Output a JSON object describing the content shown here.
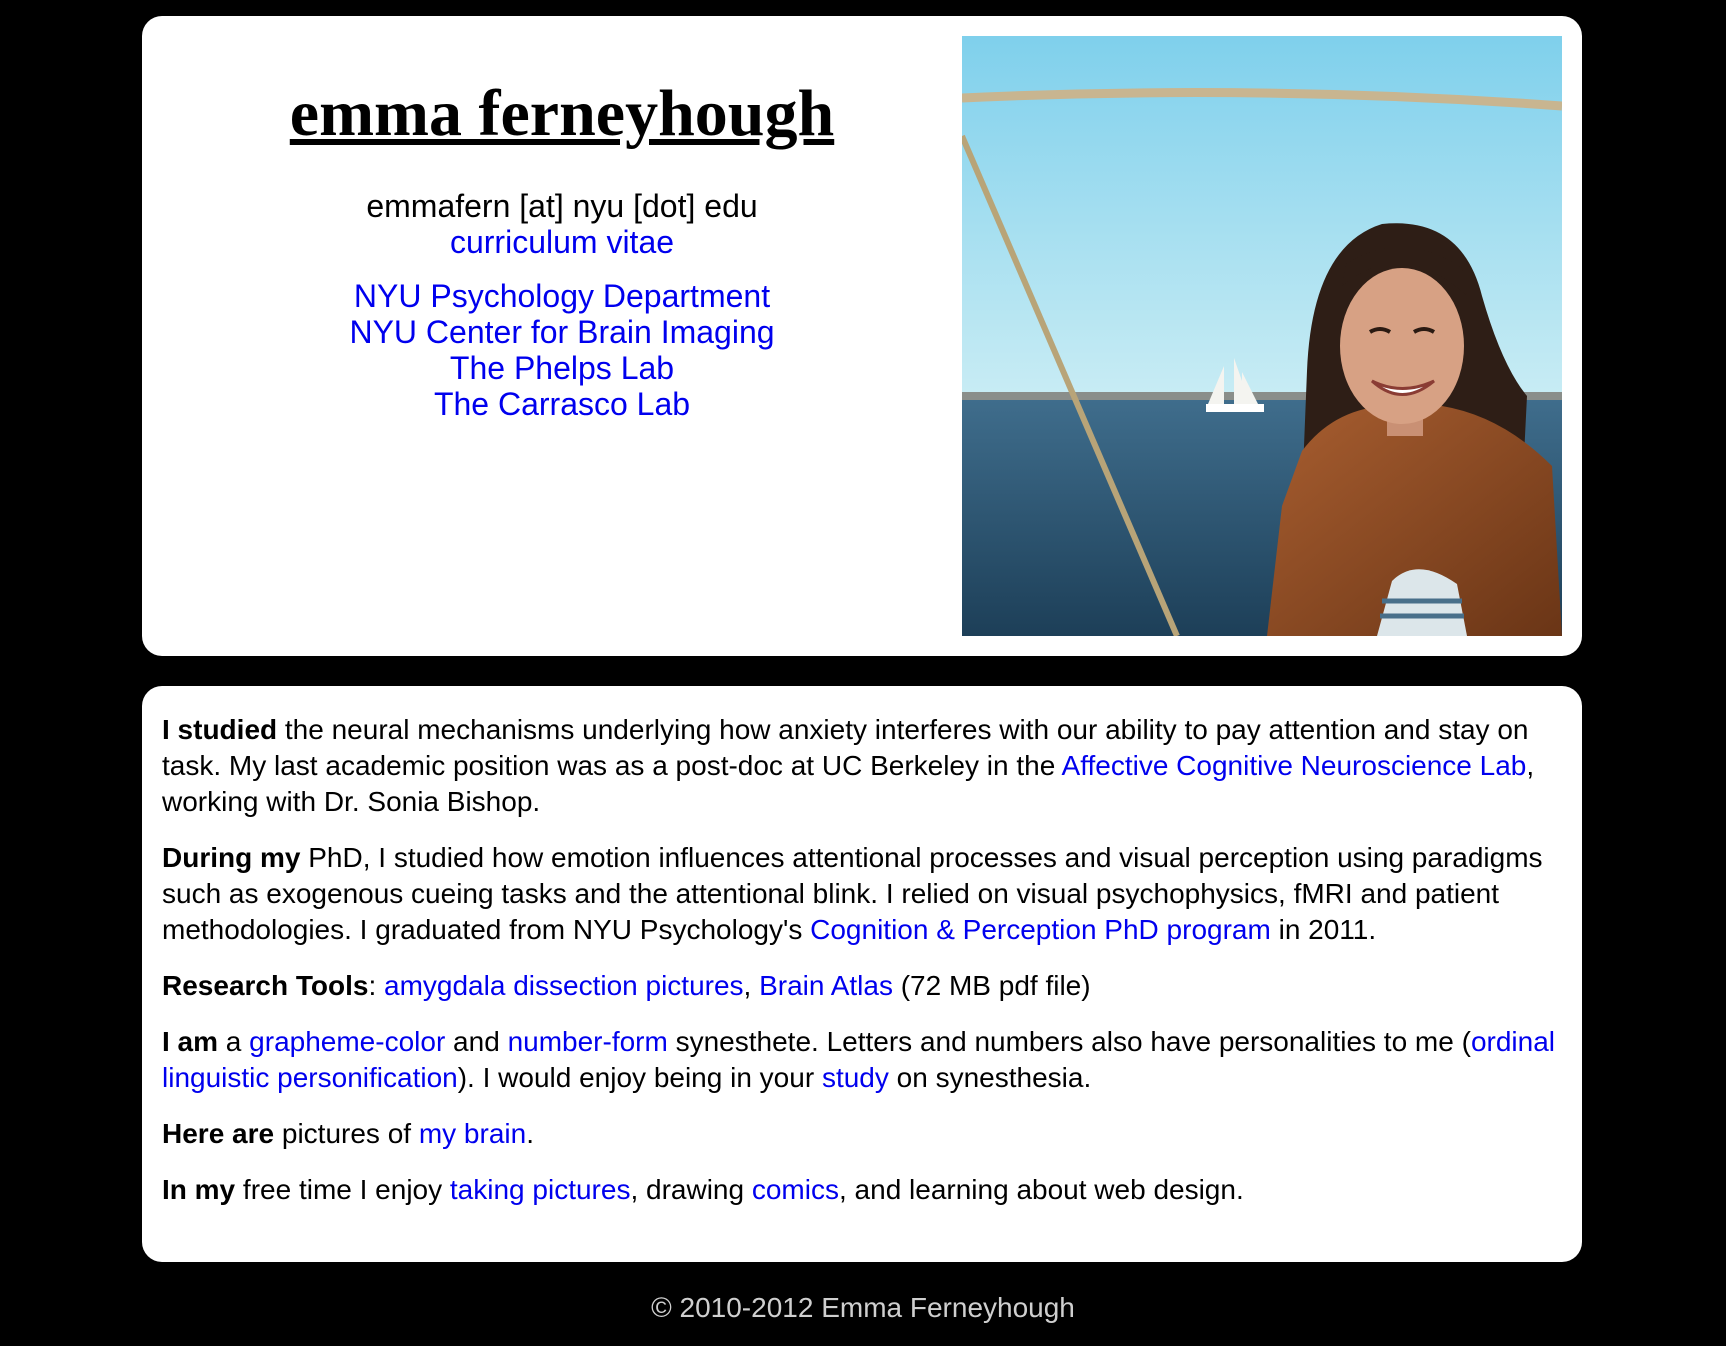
{
  "header": {
    "name": "emma ferneyhough",
    "email": "emmafern [at] nyu [dot] edu",
    "cv_link": "curriculum vitae",
    "links": [
      "NYU Psychology Department",
      "NYU Center for Brain Imaging",
      "The Phelps Lab",
      "The Carrasco Lab"
    ]
  },
  "colors": {
    "background": "#000000",
    "panel": "#ffffff",
    "link": "#0000ee",
    "footer_text": "#cfcfcf"
  },
  "about": {
    "p1": {
      "bold": "I studied",
      "t1": " the neural mechanisms underlying how anxiety interferes with our ability to pay attention and stay on task. My last academic position was as a post-doc at UC Berkeley in the ",
      "link1": "Affective Cognitive Neuroscience Lab",
      "t2": ", working with Dr. Sonia Bishop."
    },
    "p2": {
      "bold": "During my",
      "t1": " PhD, I studied how emotion influences attentional processes and visual perception using paradigms such as exogenous cueing tasks and the attentional blink. I relied on visual psychophysics, fMRI and patient methodologies. I graduated from NYU Psychology's ",
      "link1": "Cognition & Perception PhD program",
      "t2": " in 2011."
    },
    "p3": {
      "bold": "Research Tools",
      "t1": ": ",
      "link1": "amygdala dissection pictures",
      "t2": ", ",
      "link2": "Brain Atlas",
      "t3": " (72 MB pdf file)"
    },
    "p4": {
      "bold": "I am",
      "t1": " a ",
      "link1": "grapheme-color",
      "t2": " and ",
      "link2": "number-form",
      "t3": " synesthete. Letters and numbers also have personalities to me (",
      "link3": "ordinal linguistic personification",
      "t4": "). I would enjoy being in your ",
      "link4": "study",
      "t5": " on synesthesia."
    },
    "p5": {
      "bold": "Here are",
      "t1": " pictures of ",
      "link1": "my brain",
      "t2": "."
    },
    "p6": {
      "bold": "In my",
      "t1": " free time I enjoy ",
      "link1": "taking pictures",
      "t2": ", drawing ",
      "link2": "comics",
      "t3": ", and learning about web design."
    }
  },
  "footer": {
    "text": "© 2010-2012 Emma Ferneyhough"
  }
}
